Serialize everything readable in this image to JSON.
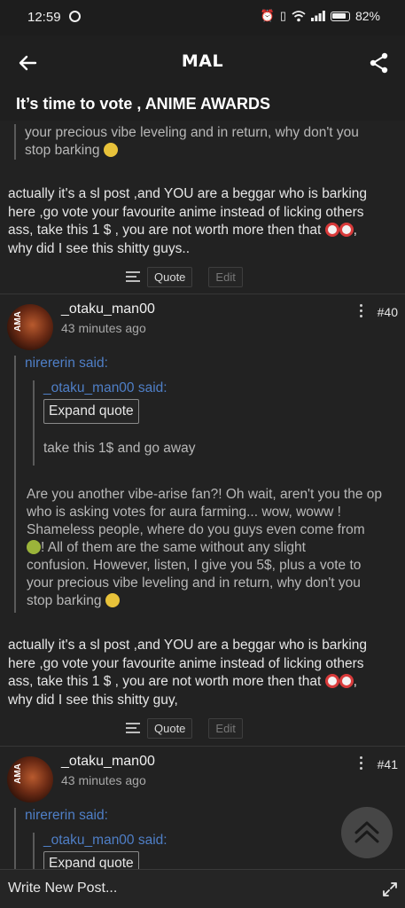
{
  "status_bar": {
    "time": "12:59",
    "battery": "82%",
    "left_icon": "pinterest-icon",
    "right_icons": [
      "alarm-icon",
      "vibrate-icon",
      "wifi-icon",
      "signal-icon",
      "battery-icon"
    ]
  },
  "app_bar": {
    "back_icon": "arrow-left-icon",
    "logo": "MAL",
    "share_icon": "share-icon"
  },
  "thread": {
    "title": "It’s time to vote , ANIME AWARDS"
  },
  "post_prev": {
    "quote_line1": "your precious vibe leveling and in return, why don't you",
    "quote_line2": "stop barking",
    "body": {
      "line1": "actually it's a sl post ,and YOU are a beggar who is barking",
      "line2": "here ,go vote your favourite anime instead of licking others",
      "line3": "ass, take this 1 $ , you are not worth more then that",
      "line4": "why did I see this shitty guys.."
    },
    "quote_button": "Quote",
    "edit_button": "Edit"
  },
  "post_40": {
    "username": "_otaku_man00",
    "time_ago": "43 minutes ago",
    "number": "#40",
    "avatar_text": "AMA",
    "outer_quote_author": "nirererin said:",
    "inner_quote_author": "_otaku_man00 said:",
    "expand_quote": "Expand quote",
    "inner_quote_text": "take this 1$ and go away",
    "outer_quote_text": {
      "line1": "Are you another vibe-arise fan?! Oh wait, aren't you the op",
      "line2": "who is asking votes for aura farming... wow, woww !",
      "line3": "Shameless people, where do you guys even come from",
      "line4": "! All of them are the same without any slight",
      "line5": "confusion. However, listen, I give you 5$, plus a vote to",
      "line6": "your precious vibe leveling and in return, why don't you",
      "line7": "stop barking"
    },
    "body": {
      "line1": "actually it's a sl post ,and YOU are a beggar who is barking",
      "line2": "here ,go vote your favourite anime instead of licking others",
      "line3": "ass, take this 1 $ , you are not worth more then that",
      "line4": "why did I see this shitty guy,"
    },
    "quote_button": "Quote",
    "edit_button": "Edit"
  },
  "post_41": {
    "username": "_otaku_man00",
    "time_ago": "43 minutes ago",
    "number": "#41",
    "avatar_text": "AMA",
    "outer_quote_author": "nirererin said:",
    "inner_quote_author": "_otaku_man00 said:",
    "expand_quote": "Expand quote"
  },
  "fab": {
    "icon": "double-chevron-up-icon"
  },
  "bottom_bar": {
    "placeholder": "Write New Post...",
    "expand_icon": "expand-diagonal-icon"
  },
  "colors": {
    "background": "#222222",
    "bar": "#1f1f1f",
    "link_blue": "#4f7fc7",
    "text": "#e6e6e6",
    "muted": "#a8a8a8"
  }
}
